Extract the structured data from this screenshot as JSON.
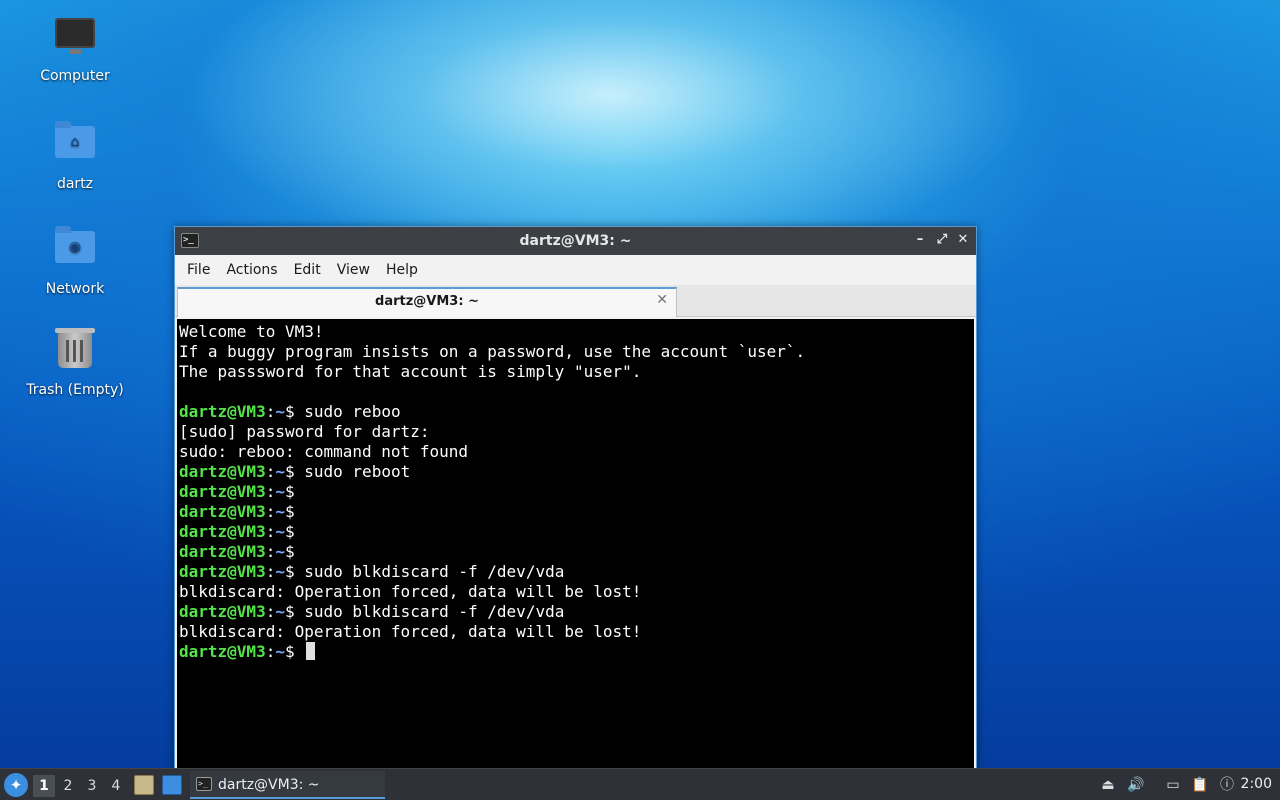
{
  "desktop": {
    "icons": [
      {
        "label": "Computer"
      },
      {
        "label": "dartz"
      },
      {
        "label": "Network"
      },
      {
        "label": "Trash (Empty)"
      }
    ]
  },
  "window": {
    "title": "dartz@VM3: ~",
    "app_icon_glyph": ">_",
    "controls": {
      "minimize": "–",
      "maximize": "⤢",
      "close": "✕"
    },
    "menu": [
      "File",
      "Actions",
      "Edit",
      "View",
      "Help"
    ],
    "tab": {
      "title": "dartz@VM3: ~",
      "close": "✕"
    }
  },
  "terminal": {
    "prompt_user": "dartz@VM3",
    "prompt_sep": ":",
    "prompt_path": "~",
    "prompt_end": "$",
    "lines": [
      {
        "type": "text",
        "text": "Welcome to VM3!"
      },
      {
        "type": "text",
        "text": "If a buggy program insists on a password, use the account `user`."
      },
      {
        "type": "text",
        "text": "The passsword for that account is simply \"user\"."
      },
      {
        "type": "text",
        "text": ""
      },
      {
        "type": "prompt",
        "cmd": " sudo reboo"
      },
      {
        "type": "text",
        "text": "[sudo] password for dartz:"
      },
      {
        "type": "text",
        "text": "sudo: reboo: command not found"
      },
      {
        "type": "prompt",
        "cmd": " sudo reboot"
      },
      {
        "type": "prompt",
        "cmd": ""
      },
      {
        "type": "prompt",
        "cmd": ""
      },
      {
        "type": "prompt",
        "cmd": ""
      },
      {
        "type": "prompt",
        "cmd": ""
      },
      {
        "type": "prompt",
        "cmd": " sudo blkdiscard -f /dev/vda"
      },
      {
        "type": "text",
        "text": "blkdiscard: Operation forced, data will be lost!"
      },
      {
        "type": "prompt",
        "cmd": " sudo blkdiscard -f /dev/vda"
      },
      {
        "type": "text",
        "text": "blkdiscard: Operation forced, data will be lost!"
      },
      {
        "type": "prompt",
        "cmd": " ",
        "cursor": true
      }
    ]
  },
  "taskbar": {
    "desktops": [
      "1",
      "2",
      "3",
      "4"
    ],
    "active_desktop": "1",
    "task_label": "dartz@VM3: ~",
    "task_icon_glyph": ">_",
    "clock": "2:00",
    "colors": {
      "accent": "#5b9bd5",
      "prompt_user": "#55e34a",
      "prompt_path": "#7aa6ff"
    }
  }
}
